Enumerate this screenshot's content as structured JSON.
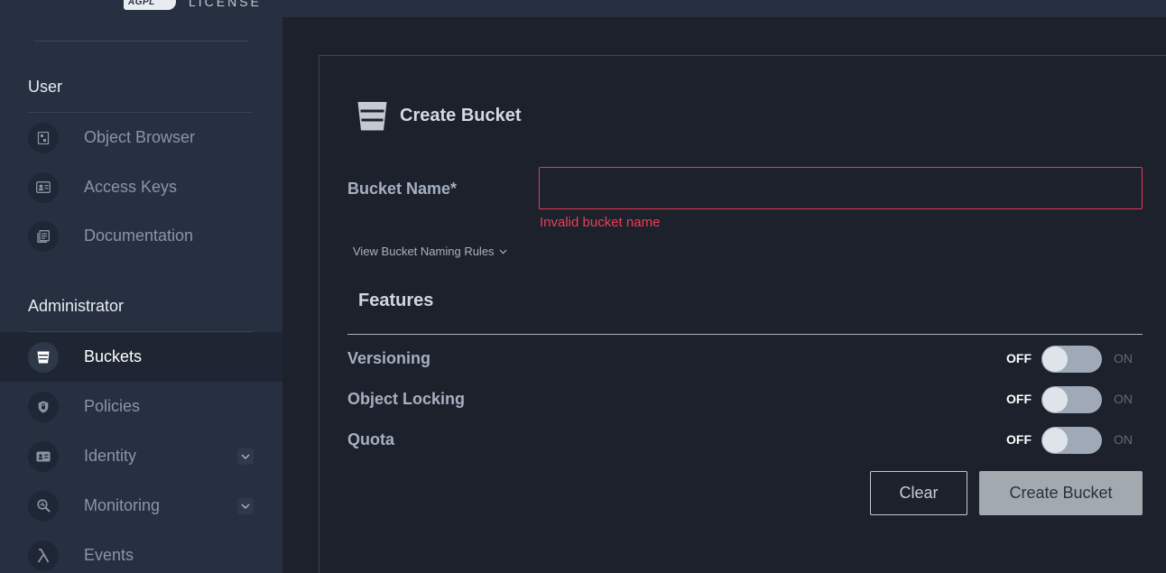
{
  "brand": {
    "logo_mark": "AGPL",
    "logo_text": "LICENSE"
  },
  "sidebar": {
    "user_section": {
      "title": "User",
      "items": [
        {
          "label": "Object Browser",
          "icon": "object-browser-icon"
        },
        {
          "label": "Access Keys",
          "icon": "access-keys-icon"
        },
        {
          "label": "Documentation",
          "icon": "documentation-icon"
        }
      ]
    },
    "admin_section": {
      "title": "Administrator",
      "items": [
        {
          "label": "Buckets",
          "icon": "bucket-icon",
          "active": true
        },
        {
          "label": "Policies",
          "icon": "policies-icon"
        },
        {
          "label": "Identity",
          "icon": "identity-icon",
          "expandable": true
        },
        {
          "label": "Monitoring",
          "icon": "monitoring-icon",
          "expandable": true
        },
        {
          "label": "Events",
          "icon": "lambda-icon"
        }
      ]
    }
  },
  "form": {
    "title": "Create Bucket",
    "bucket_name_label": "Bucket Name*",
    "bucket_name_value": "",
    "error": "Invalid bucket name",
    "naming_rules_link": "View Bucket Naming Rules",
    "features_title": "Features",
    "features": [
      {
        "label": "Versioning",
        "off": "OFF",
        "on": "ON",
        "enabled": false
      },
      {
        "label": "Object Locking",
        "off": "OFF",
        "on": "ON",
        "enabled": false
      },
      {
        "label": "Quota",
        "off": "OFF",
        "on": "ON",
        "enabled": false
      }
    ],
    "clear_button": "Clear",
    "create_button": "Create Bucket"
  },
  "colors": {
    "sidebar_bg": "#263041",
    "content_bg": "#1c212b",
    "error": "#ee3d56",
    "create_button_bg": "#a3aaaf"
  }
}
